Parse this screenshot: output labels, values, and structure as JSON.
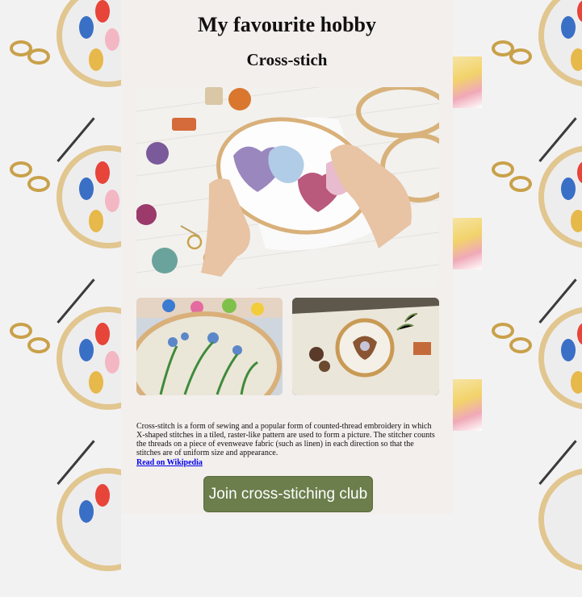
{
  "page": {
    "title": "My favourite hobby",
    "subtitle": "Cross-stich"
  },
  "images": {
    "main": {
      "icon": "embroidery-hoop-photo"
    },
    "left": {
      "icon": "floral-embroidery-photo"
    },
    "right": {
      "icon": "embroidery-on-linen-photo"
    }
  },
  "content": {
    "description": "Cross-stitch is a form of sewing and a popular form of counted-thread embroidery in which X-shaped stitches in a tiled, raster-like pattern are used to form a picture. The stitcher counts the threads on a piece of evenweave fabric (such as linen) in each direction so that the stitches are of uniform size and appearance.",
    "link_text": "Read on Wikipedia",
    "button_label": "Join cross-stiching club"
  },
  "colors": {
    "card_background": "#f3efec",
    "button": "#6b7e4c",
    "link": "#0000ee"
  }
}
